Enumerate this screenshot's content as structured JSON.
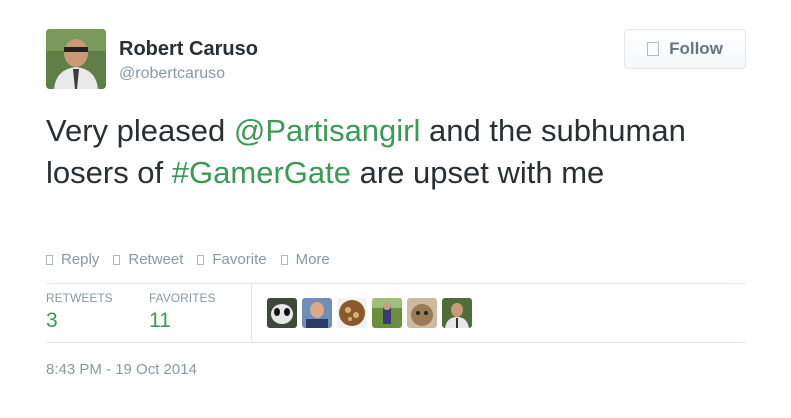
{
  "author": {
    "name": "Robert Caruso",
    "handle": "@robertcaruso"
  },
  "follow": {
    "label": "Follow",
    "icon": "follow-user-icon"
  },
  "tweet": {
    "part1": "Very pleased ",
    "mention": "@Partisangirl",
    "part2": " and the subhuman losers of ",
    "hashtag": "#GamerGate",
    "part3": " are upset with me"
  },
  "actions": [
    {
      "label": "Reply",
      "icon": "reply-icon"
    },
    {
      "label": "Retweet",
      "icon": "retweet-icon"
    },
    {
      "label": "Favorite",
      "icon": "favorite-icon"
    },
    {
      "label": "More",
      "icon": "more-icon"
    }
  ],
  "stats": {
    "retweets_label": "RETWEETS",
    "retweets_count": "3",
    "favorites_label": "FAVORITES",
    "favorites_count": "11"
  },
  "timestamp": "8:43 PM - 19 Oct 2014",
  "colors": {
    "link": "#3b9a55",
    "muted": "#8899a6",
    "text": "#292f33"
  }
}
